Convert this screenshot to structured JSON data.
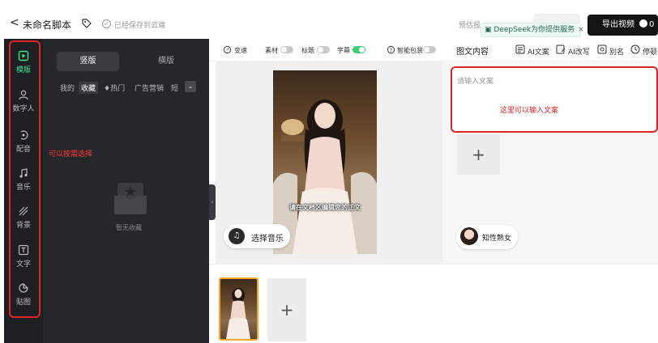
{
  "header": {
    "back_glyph": "<",
    "title": "未命名脚本",
    "save_status": "已经保存到云端",
    "predict_label": "预估报",
    "deepseek_text": "DeepSeek为你提供服务",
    "deepseek_close": "×",
    "export_label": "导出视频",
    "export_count": "0"
  },
  "sidebar": {
    "items": [
      {
        "label": "模版",
        "icon": "template-icon",
        "active": true
      },
      {
        "label": "数字人",
        "icon": "digital-human-icon"
      },
      {
        "label": "配音",
        "icon": "dubbing-icon"
      },
      {
        "label": "音乐",
        "icon": "music-icon"
      },
      {
        "label": "背景",
        "icon": "background-icon"
      },
      {
        "label": "文字",
        "icon": "text-icon"
      },
      {
        "label": "贴图",
        "icon": "sticker-icon"
      }
    ],
    "annotation": "可以按需选择"
  },
  "panel": {
    "tab_active": "竖版",
    "tab_other": "横版",
    "categories": [
      "我的",
      "收藏",
      "♦热门",
      "广告营销",
      "短"
    ],
    "empty_text": "暂无收藏"
  },
  "toolbar": {
    "speed": "变速",
    "material": "素材",
    "caption_title": "标题",
    "subtitle": "字幕",
    "smart_pack": "智能包装",
    "tab_title": "图文内容",
    "ai_copy": "AI文案",
    "ai_rewrite": "AI改写",
    "alias": "别名",
    "pause": "停顿"
  },
  "preview": {
    "caption": "请在文档区编辑您的正文",
    "music_button": "选择音乐"
  },
  "text_panel": {
    "placeholder": "请输入文案",
    "annotation": "这里可以输入文案",
    "add_glyph": "+",
    "voice_label": "知性熟女"
  },
  "timeline": {
    "add_glyph": "+"
  },
  "colors": {
    "accent": "#3ee28e",
    "annotation_red": "#e02424",
    "dark_panel": "#26272b"
  }
}
